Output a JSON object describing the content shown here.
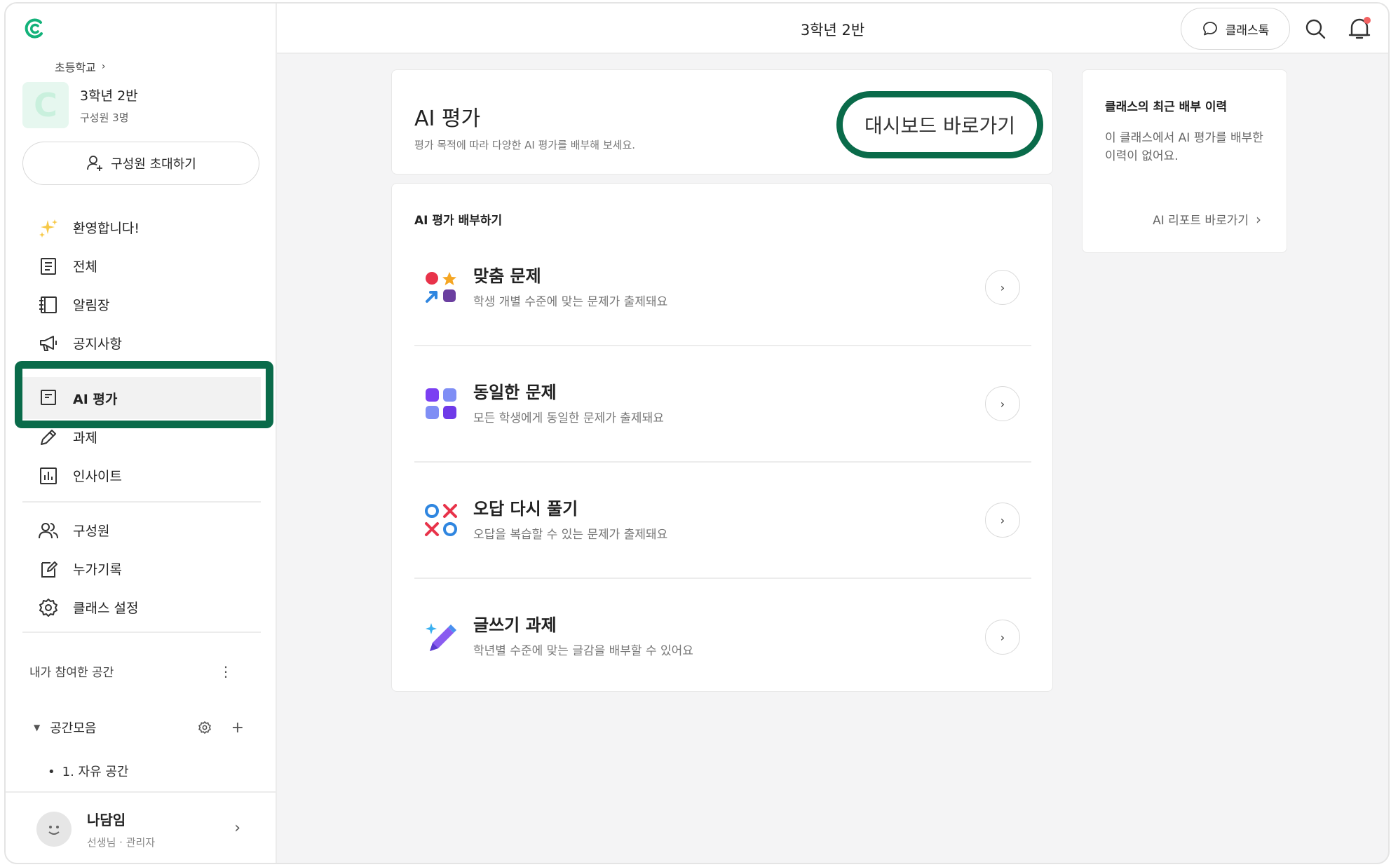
{
  "colors": {
    "accent": "#0a6b4a",
    "brand": "#13b27a",
    "notify": "#f26161"
  },
  "sidebar": {
    "breadcrumb": "초등학교",
    "class_initial": "C",
    "class_name": "3학년 2반",
    "class_members": "구성원 3명",
    "invite_label": "구성원 초대하기",
    "nav": [
      {
        "label": "환영합니다!",
        "icon": "sparkle-icon"
      },
      {
        "label": "전체",
        "icon": "document-icon"
      },
      {
        "label": "알림장",
        "icon": "notebook-icon"
      },
      {
        "label": "공지사항",
        "icon": "megaphone-icon"
      },
      {
        "label": "AI 평가",
        "icon": "book-icon"
      },
      {
        "label": "과제",
        "icon": "pencil-icon"
      },
      {
        "label": "인사이트",
        "icon": "chart-icon"
      },
      {
        "label": "구성원",
        "icon": "members-icon"
      },
      {
        "label": "누가기록",
        "icon": "record-icon"
      },
      {
        "label": "클래스 설정",
        "icon": "gear-icon"
      }
    ],
    "spaces_heading": "내가 참여한 공간",
    "space_group": "공간모음",
    "space_item": "1. 자유 공간",
    "profile_name": "나담임",
    "profile_role": "선생님 · 관리자"
  },
  "topbar": {
    "title": "3학년 2반",
    "talk_label": "클래스톡"
  },
  "header_card": {
    "title": "AI 평가",
    "subtitle": "평가 목적에 따라 다양한 AI 평가를 배부해 보세요.",
    "dashboard_label": "대시보드 바로가기"
  },
  "distribute": {
    "title": "AI 평가 배부하기",
    "items": [
      {
        "title": "맞춤 문제",
        "desc": "학생 개별 수준에 맞는 문제가 출제돼요",
        "icon": "custom-problem-icon"
      },
      {
        "title": "동일한 문제",
        "desc": "모든 학생에게 동일한 문제가 출제돼요",
        "icon": "grid-squares-icon"
      },
      {
        "title": "오답 다시 풀기",
        "desc": "오답을 복습할 수 있는 문제가 출제돼요",
        "icon": "ox-icon"
      },
      {
        "title": "글쓰기 과제",
        "desc": "학년별 수준에 맞는 글감을 배부할 수 있어요",
        "icon": "magic-pen-icon"
      }
    ]
  },
  "history_card": {
    "title": "클래스의 최근 배부 이력",
    "body": "이 클래스에서 AI 평가를 배부한 이력이 없어요.",
    "link_label": "AI 리포트 바로가기"
  }
}
